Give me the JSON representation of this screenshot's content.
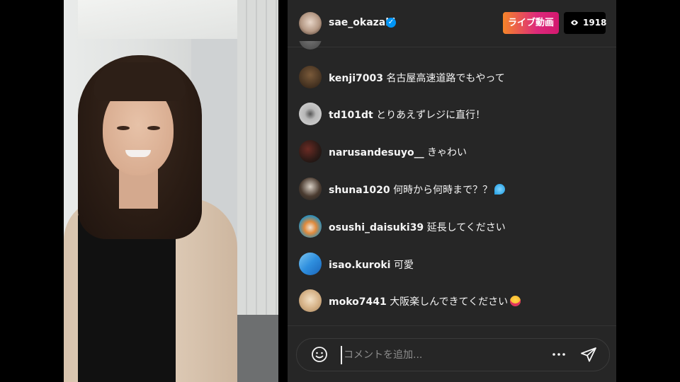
{
  "stream": {
    "username": "sae_okazaki",
    "verified_icon": "verified-badge-icon",
    "live_label": "ライブ動画",
    "viewer_icon": "eye-icon",
    "viewer_count": "1918"
  },
  "comments": [
    {
      "user": "kenji7003",
      "text": "名古屋高速道路でもやって",
      "emoji": null
    },
    {
      "user": "td101dt",
      "text": "とりあえずレジに直行！",
      "emoji": null
    },
    {
      "user": "narusandesuyo__",
      "text": "きゃわい",
      "emoji": null
    },
    {
      "user": "shuna1020",
      "text": "何時から何時まで？？",
      "emoji": "sweat-droplets-emoji"
    },
    {
      "user": "osushi_daisuki39",
      "text": "延長してください",
      "emoji": null
    },
    {
      "user": "isao.kuroki",
      "text": "可愛",
      "emoji": null
    },
    {
      "user": "moko7441",
      "text": "大阪楽しんできてください",
      "emoji": "star-struck-emoji"
    }
  ],
  "composer": {
    "emoji_icon": "smiley-icon",
    "placeholder": "コメントを追加...",
    "more_icon": "more-horizontal-icon",
    "send_icon": "send-icon"
  },
  "colors": {
    "panel_bg": "#262626",
    "accent_blue": "#0095f6",
    "live_gradient_start": "#f58529",
    "live_gradient_end": "#dd2a7b"
  }
}
